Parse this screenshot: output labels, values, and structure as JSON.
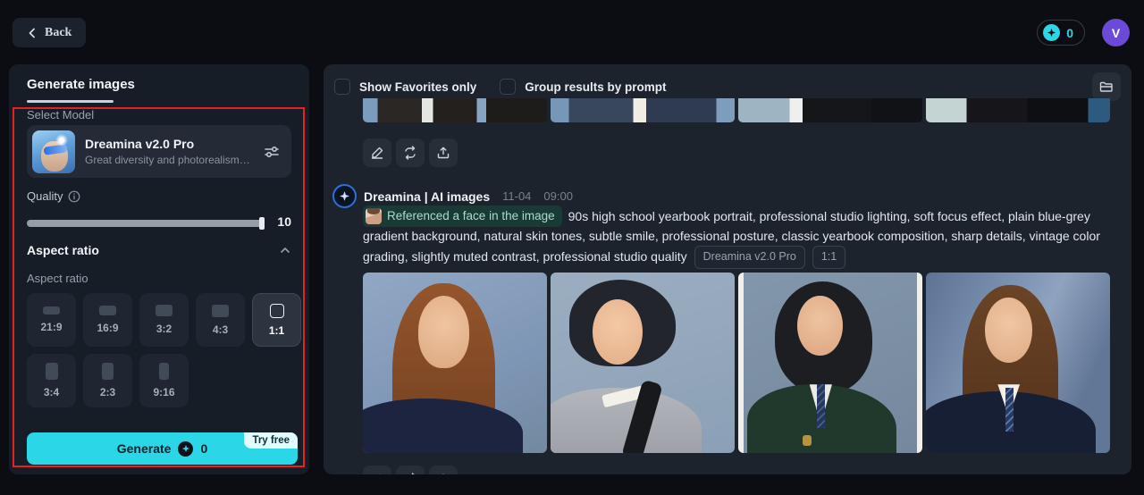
{
  "topbar": {
    "back_label": "Back",
    "credits": "0",
    "avatar_initial": "V"
  },
  "sidebar": {
    "tab_label": "Generate images",
    "select_model_label": "Select Model",
    "model": {
      "name": "Dreamina v2.0 Pro",
      "description": "Great diversity and photorealism. Of…"
    },
    "quality_label": "Quality",
    "quality_value": "10",
    "aspect": {
      "title": "Aspect ratio",
      "sub_label": "Aspect ratio",
      "selected": "1:1",
      "options": [
        "21:9",
        "16:9",
        "3:2",
        "4:3",
        "1:1",
        "3:4",
        "2:3",
        "9:16"
      ]
    },
    "generate_label": "Generate",
    "generate_credits": "0",
    "try_free_badge": "Try free"
  },
  "main": {
    "filters": [
      {
        "label": "Show Favorites only",
        "checked": false
      },
      {
        "label": "Group results by prompt",
        "checked": false
      }
    ],
    "generation": {
      "source_name": "Dreamina | AI images",
      "date": "11-04",
      "time": "09:00",
      "reference_tag": "Referenced a face in the image",
      "prompt": "90s high school yearbook portrait, professional studio lighting, soft focus effect, plain blue-grey gradient background, natural skin tones, subtle smile, professional posture, classic yearbook composition, sharp details, vintage color grading, slightly muted contrast, professional studio quality",
      "tags": [
        "Dreamina v2.0 Pro",
        "1:1"
      ]
    },
    "colors": {
      "accent_cyan": "#2bd6e6",
      "selection_red": "#e32222",
      "avatar_purple": "#6a4ad6"
    }
  }
}
